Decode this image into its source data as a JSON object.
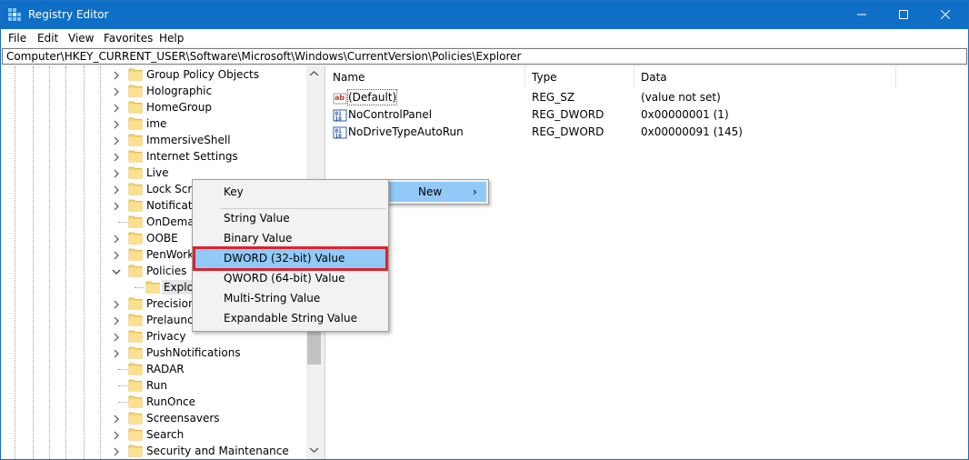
{
  "window": {
    "title": "Registry Editor"
  },
  "menu": [
    "File",
    "Edit",
    "View",
    "Favorites",
    "Help"
  ],
  "address": "Computer\\HKEY_CURRENT_USER\\Software\\Microsoft\\Windows\\CurrentVersion\\Policies\\Explorer",
  "tree": {
    "items": [
      {
        "label": "Group Policy Objects",
        "expander": "collapsed"
      },
      {
        "label": "Holographic",
        "expander": "collapsed"
      },
      {
        "label": "HomeGroup",
        "expander": "collapsed"
      },
      {
        "label": "ime",
        "expander": "collapsed"
      },
      {
        "label": "ImmersiveShell",
        "expander": "collapsed"
      },
      {
        "label": "Internet Settings",
        "expander": "collapsed"
      },
      {
        "label": "Live",
        "expander": "collapsed"
      },
      {
        "label": "Lock Scre",
        "expander": "collapsed"
      },
      {
        "label": "Notificati",
        "expander": "collapsed"
      },
      {
        "label": "OnDemar",
        "expander": "none"
      },
      {
        "label": "OOBE",
        "expander": "collapsed"
      },
      {
        "label": "PenWork",
        "expander": "collapsed"
      },
      {
        "label": "Policies",
        "expander": "expanded"
      },
      {
        "label": "Explor",
        "expander": "none",
        "child": true,
        "selected": true
      },
      {
        "label": "Precision",
        "expander": "collapsed"
      },
      {
        "label": "Prelaunch",
        "expander": "collapsed"
      },
      {
        "label": "Privacy",
        "expander": "collapsed"
      },
      {
        "label": "PushNotifications",
        "expander": "collapsed"
      },
      {
        "label": "RADAR",
        "expander": "none"
      },
      {
        "label": "Run",
        "expander": "none"
      },
      {
        "label": "RunOnce",
        "expander": "none"
      },
      {
        "label": "Screensavers",
        "expander": "collapsed"
      },
      {
        "label": "Search",
        "expander": "collapsed"
      },
      {
        "label": "Security and Maintenance",
        "expander": "collapsed"
      }
    ]
  },
  "columns": {
    "name": "Name",
    "type": "Type",
    "data": "Data"
  },
  "values": [
    {
      "icon": "string-value-icon",
      "name": "(Default)",
      "type": "REG_SZ",
      "data": "(value not set)"
    },
    {
      "icon": "binary-value-icon",
      "name": "NoControlPanel",
      "type": "REG_DWORD",
      "data": "0x00000001 (1)"
    },
    {
      "icon": "binary-value-icon",
      "name": "NoDriveTypeAutoRun",
      "type": "REG_DWORD",
      "data": "0x00000091 (145)"
    }
  ],
  "context_menu": {
    "new_label": "New",
    "new_arrow": "›",
    "submenu": [
      {
        "label": "Key"
      },
      {
        "label": "String Value"
      },
      {
        "label": "Binary Value"
      },
      {
        "label": "DWORD (32-bit) Value",
        "highlighted": true
      },
      {
        "label": "QWORD (64-bit) Value"
      },
      {
        "label": "Multi-String Value"
      },
      {
        "label": "Expandable String Value"
      }
    ]
  },
  "colors": {
    "titlebar": "#0f6fc6",
    "menu_highlight": "#91c9f7",
    "callout_border": "#e2202c"
  }
}
